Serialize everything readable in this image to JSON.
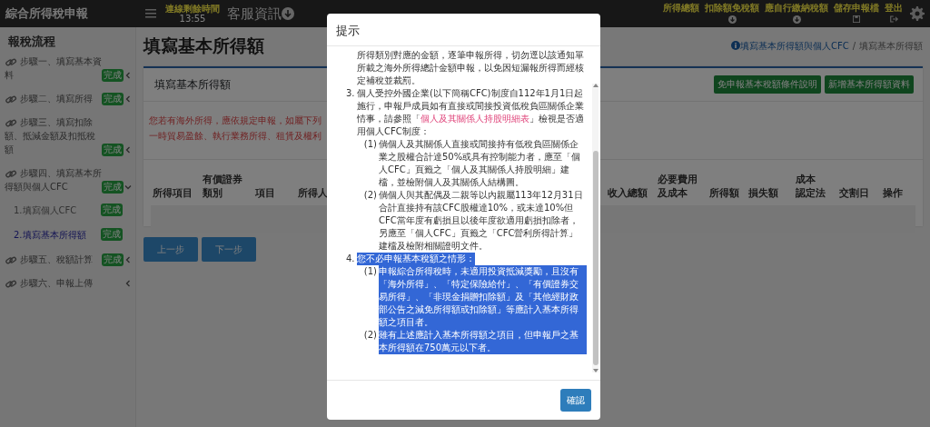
{
  "app_title": "綜合所得稅申報",
  "session": {
    "label": "連線剩餘時間",
    "time": "13:55"
  },
  "service": {
    "label": "客服資訊"
  },
  "top_actions": [
    {
      "label": "所得總額",
      "kind": "amount"
    },
    {
      "label": "扣除額免稅額",
      "kind": "down"
    },
    {
      "label": "應自行繳納稅額",
      "kind": "down"
    },
    {
      "label": "儲存申報檔",
      "kind": "save"
    },
    {
      "label": "登出",
      "kind": "logout"
    }
  ],
  "sidebar": {
    "title": "報稅流程",
    "steps": [
      {
        "label": "步驟一、填寫基本資料",
        "badge": "完成",
        "expanded": false
      },
      {
        "label": "步驟二、填寫所得",
        "badge": "完成",
        "expanded": false
      },
      {
        "label": "步驟三、填寫扣除額、抵減金額及扣抵稅額",
        "badge": "完成",
        "expanded": false
      },
      {
        "label": "步驟四、填寫基本所得額與個人CFC",
        "badge": "完成",
        "expanded": true,
        "children": [
          {
            "label": "1.填寫個人CFC",
            "badge": "完成",
            "selected": false
          },
          {
            "label": "2.填寫基本所得額",
            "badge": "完成",
            "selected": true
          }
        ]
      },
      {
        "label": "步驟五、稅額計算",
        "badge": "完成",
        "expanded": false
      },
      {
        "label": "步驟六、申報上傳",
        "expanded": false
      }
    ]
  },
  "page_title": "填寫基本所得額",
  "breadcrumb": [
    {
      "label": "填寫基本所得額與個人CFC",
      "link": true
    },
    {
      "label": "填寫基本所得額",
      "link": false
    }
  ],
  "breadcrumb_separator": "/",
  "card": {
    "title": "填寫基本所得額",
    "buttons": [
      "免申報基本稅額條件說明",
      "新增基本所得額資料"
    ],
    "notice": [
      "您若有海外所得，應依規定申報，如屬下列",
      "一時貿易盈餘、執行業務所得、租賃及權利"
    ],
    "columns_left": [
      {
        "lines": [
          "所得項目"
        ]
      },
      {
        "lines": [
          "有價證券",
          "類別"
        ]
      },
      {
        "lines": [
          "項目"
        ]
      },
      {
        "lines": [
          "所得人"
        ]
      }
    ],
    "columns_right": [
      {
        "lines": [
          "收入總額"
        ]
      },
      {
        "lines": [
          "必要費用",
          "及成本"
        ]
      },
      {
        "lines": [
          "所得額"
        ]
      },
      {
        "lines": [
          "損失額"
        ]
      },
      {
        "lines": [
          "成本",
          "認定法"
        ]
      },
      {
        "lines": [
          "交割日"
        ]
      },
      {
        "lines": [
          "操作"
        ]
      }
    ]
  },
  "nav_buttons": [
    "上一步",
    "下一步"
  ],
  "modal": {
    "title": "提示",
    "confirm": "確認",
    "items": [
      {
        "text": "所得類別對應的金額，逐筆申報所得，切勿逕以該通知單所載之海外所得總計金額申報，以免因短漏報所得而經核定補稅並裁罰。",
        "highlighted": false
      },
      {
        "marker": "3.",
        "text": "個人受控外國企業(以下簡稱CFC)制度自112年1月1日起施行，申報戶成員如有直接或間接投資低稅負區關係企業情事，請參照「",
        "link": "個人及其關係人持股明細表",
        "text_after": "」檢視是否適用個人CFC制度：",
        "highlighted": false,
        "children": [
          {
            "marker": "(1)",
            "text": "倘個人及其關係人直接或間接持有低稅負區關係企業之股權合計達50%或具有控制能力者，應至「個人CFC」頁籤之「個人及其關係人持股明細」建檔，並檢附個人及其關係人結構圖。",
            "highlighted": false
          },
          {
            "marker": "(2)",
            "text": "倘個人與其配偶及二親等以內親屬113年12月31日合計直接持有該CFC股權達10%，或未達10%但CFC當年度有虧損且以後年度欲適用虧損扣除者，另應至「個人CFC」頁籤之「CFC營利所得計算」建檔及檢附相關證明文件。",
            "highlighted": false
          }
        ]
      },
      {
        "marker": "4.",
        "text": "您不必申報基本稅額之情形：",
        "highlighted": true,
        "children": [
          {
            "marker": "(1)",
            "text": "申報綜合所得稅時，未適用投資抵減獎勵，且沒有「海外所得」、「特定保險給付」、「有價證券交易所得」、「非現金捐贈扣除額」及「其他經財政部公告之減免所得額或扣除額」等應計入基本所得額之項目者。",
            "highlighted": true
          },
          {
            "marker": "(2)",
            "text": "雖有上述應計入基本所得額之項目，但申報戶之基本所得額在750萬元以下者。",
            "highlighted": true
          }
        ]
      }
    ]
  }
}
